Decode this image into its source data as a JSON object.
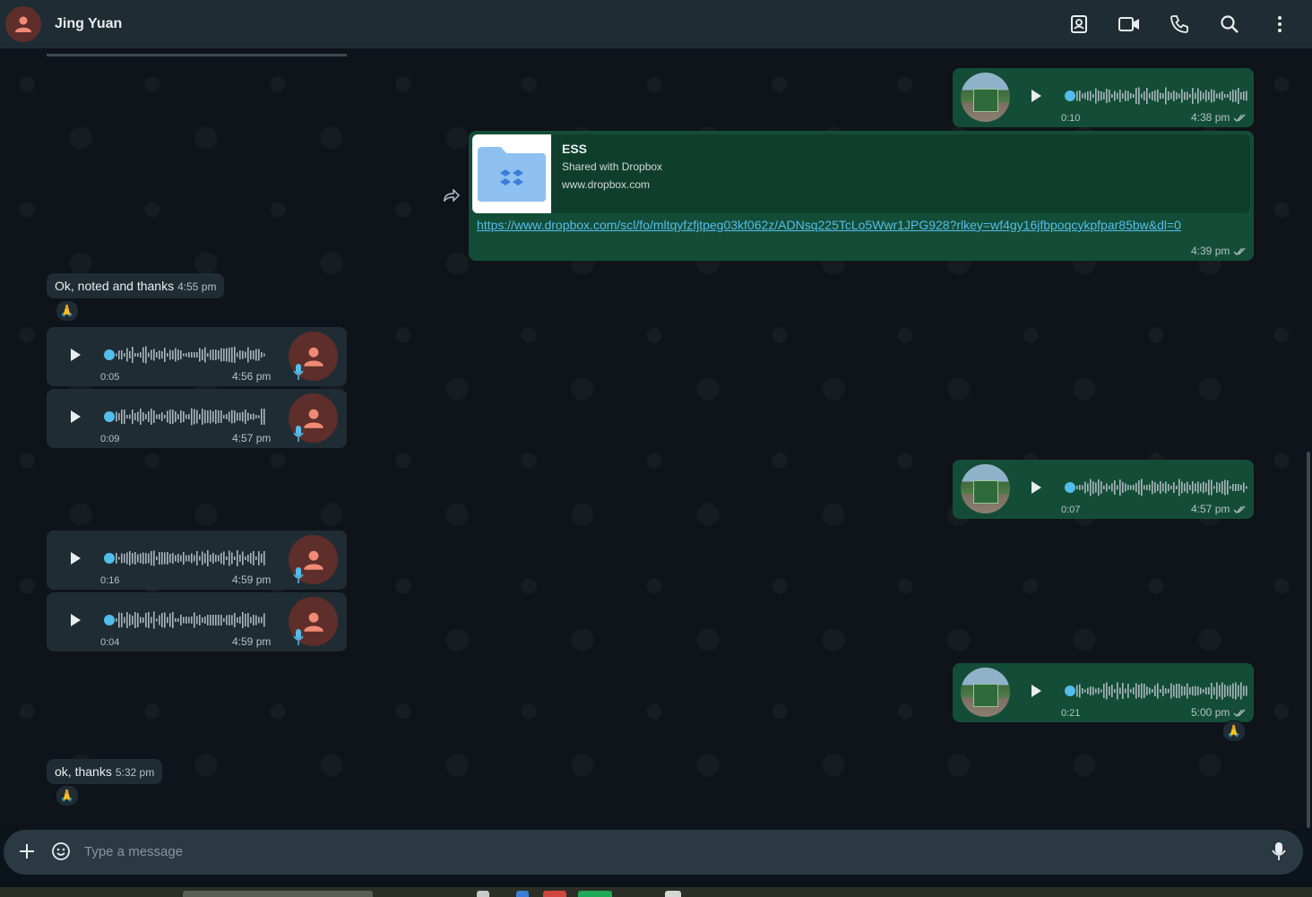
{
  "header": {
    "contact_name": "Jing Yuan",
    "icons": [
      "contacts-book-icon",
      "video-call-icon",
      "voice-call-icon",
      "search-icon",
      "more-options-icon"
    ]
  },
  "messages": {
    "m1": {
      "duration": "0:10",
      "time": "4:38 pm"
    },
    "m2": {
      "title": "ESS",
      "subtitle": "Shared with Dropbox",
      "domain": "www.dropbox.com",
      "url": "https://www.dropbox.com/scl/fo/mltqyfzfjtpeg03kf062z/ADNsq225TcLo5Wwr1JPG928?rlkey=wf4gy16jfbpoqcykpfpar85bw&dl=0",
      "time": "4:39 pm"
    },
    "m3": {
      "text": "Ok, noted and thanks",
      "time": "4:55 pm",
      "reaction": "🙏"
    },
    "m4": {
      "duration": "0:05",
      "time": "4:56 pm"
    },
    "m5": {
      "duration": "0:09",
      "time": "4:57 pm"
    },
    "m6": {
      "duration": "0:07",
      "time": "4:57 pm"
    },
    "m7": {
      "duration": "0:16",
      "time": "4:59 pm"
    },
    "m8": {
      "duration": "0:04",
      "time": "4:59 pm"
    },
    "m9": {
      "duration": "0:21",
      "time": "5:00 pm",
      "reaction": "🙏"
    },
    "m10": {
      "text": "ok, thanks",
      "time": "5:32 pm",
      "reaction": "🙏"
    }
  },
  "composer": {
    "placeholder": "Type a message"
  },
  "colors": {
    "outgoing": "#144d37",
    "incoming": "#202c33",
    "accent": "#53bdeb",
    "header": "#1f2c33"
  }
}
